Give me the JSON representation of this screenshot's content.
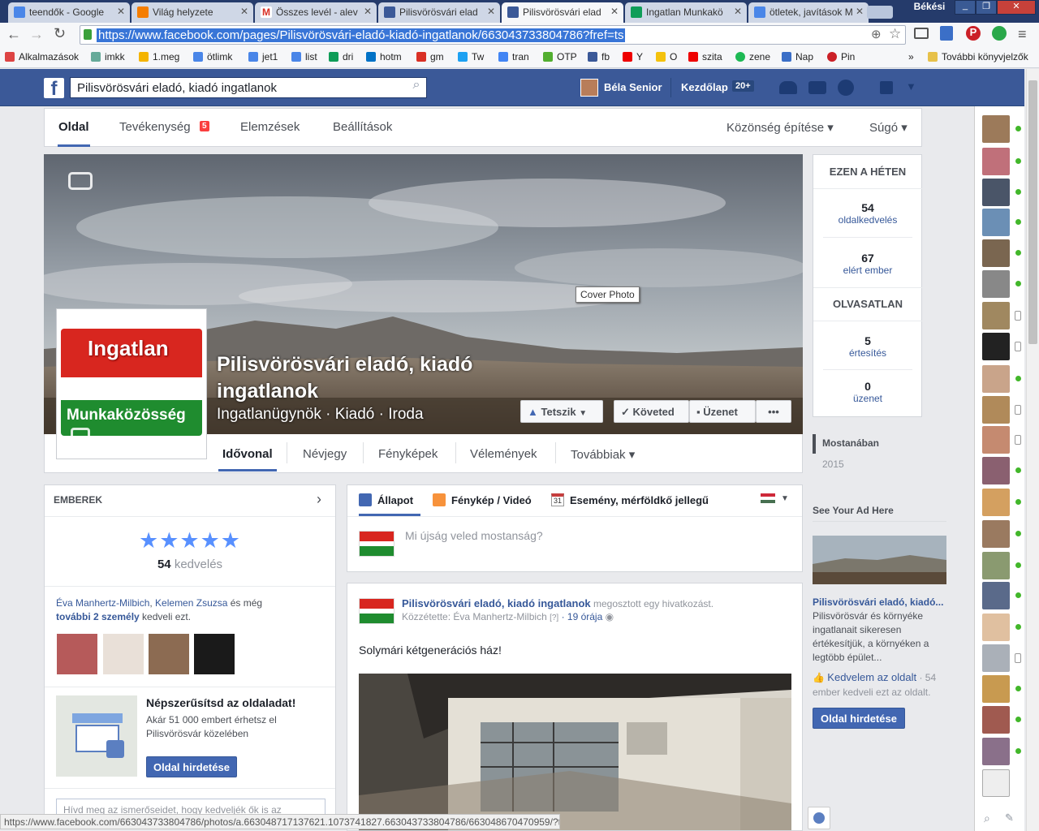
{
  "browser": {
    "tabs": [
      {
        "label": "teendők - Google",
        "color": "#4a86e8"
      },
      {
        "label": "Világ helyzete",
        "color": "#f57d00"
      },
      {
        "label": "Összes levél - alev",
        "color": "#d93025"
      },
      {
        "label": "Pilisvörösvári elad",
        "color": "#3b5998"
      },
      {
        "label": "Pilisvörösvári elad",
        "color": "#3b5998"
      },
      {
        "label": "Ingatlan Munkakö",
        "color": "#0f9d58"
      },
      {
        "label": "ötletek, javítások M",
        "color": "#4a86e8"
      }
    ],
    "user_label": "Békési",
    "url": "https://www.facebook.com/pages/Pilisvörösvári-eladó-kiadó-ingatlanok/663043733804786?fref=ts",
    "bookmarks": [
      "Alkalmazások",
      "imkk",
      "1.meg",
      "ötlimk",
      "jet1",
      "list",
      "dri",
      "hotm",
      "gm",
      "Tw",
      "tran",
      "OTP",
      "fb",
      "Y",
      "O",
      "szita",
      "zene",
      "Nap",
      "Pin"
    ],
    "bookmarks_more": "»",
    "bookmarks_folder": "További könyvjelzők",
    "status_url": "https://www.facebook.com/663043733804786/photos/a.663048717137621.1073741827.663043733804786/663048670470959/?type=1"
  },
  "fb_header": {
    "logo": "f",
    "search_value": "Pilisvörösvári eladó, kiadó ingatlanok",
    "user_name": "Béla Senior",
    "home_label": "Kezdőlap",
    "home_badge": "20+"
  },
  "page_nav": {
    "items": [
      "Oldal",
      "Tevékenység",
      "Elemzések",
      "Beállítások"
    ],
    "activity_badge": "5",
    "right": [
      "Közönség építése ▾",
      "Súgó ▾"
    ]
  },
  "cover": {
    "tooltip": "Cover Photo",
    "title_line1": "Pilisvörösvári eladó, kiadó",
    "title_line2": "ingatlanok",
    "categories": "Ingatlanügynök · Kiadó · Iroda",
    "profile_top": "Ingatlan",
    "profile_bottom": "Munkaközösség",
    "btn_like": "Tetszik",
    "btn_follow": "Követed",
    "btn_message": "Üzenet",
    "btn_more": "•••",
    "tabs": [
      "Idővonal",
      "Névjegy",
      "Fényképek",
      "Vélemények",
      "Továbbiak ▾"
    ]
  },
  "this_week": {
    "title": "EZEN A HÉTEN",
    "likes_value": "54",
    "likes_label": "oldalkedvelés",
    "reach_value": "67",
    "reach_label": "elért ember",
    "unread_title": "OLVASATLAN",
    "notif_value": "5",
    "notif_label": "értesítés",
    "msg_value": "0",
    "msg_label": "üzenet"
  },
  "timeline_nav": {
    "recent": "Mostanában",
    "year": "2015"
  },
  "ads": {
    "title": "See Your Ad Here",
    "page_name": "Pilisvörösvári eladó, kiadó...",
    "desc": "Pilisvörösvár és környéke ingatlanait sikeresen értékesítjük, a környéken a legtöbb épület...",
    "like_link": "Kedvelem az oldalt",
    "like_tail": " · 54",
    "like_count": "ember kedveli ezt az oldalt.",
    "button": "Oldal hirdetése"
  },
  "people": {
    "title": "EMBEREK",
    "stars": "★★★★★",
    "likes_value": "54",
    "likes_label": "kedvelés",
    "friend1": "Éva Manhertz-Milbich",
    "sep": ", ",
    "friend2": "Kelemen Zsuzsa",
    "and_more": " és még",
    "others": "további 2 személy",
    "likes_this": " kedveli ezt.",
    "promote_title": "Népszerűsítsd az oldaladat!",
    "promote_text": "Akár 51 000 embert érhetsz el Pilisvörösvár közelében",
    "promote_button": "Oldal hirdetése",
    "invite_placeholder": "Hívd meg az ismerőseidet, hogy kedveljék ők is az"
  },
  "composer": {
    "tab_status": "Állapot",
    "tab_photo": "Fénykép / Videó",
    "tab_event": "Esemény, mérföldkő jellegű",
    "calendar_day": "31",
    "placeholder": "Mi újság veled mostanság?"
  },
  "post": {
    "page_name": "Pilisvörösvári eladó, kiadó ingatlanok",
    "action": " megosztott egy hivatkozást.",
    "posted_by": "Közzétette: Éva Manhertz-Milbich",
    "qmark": "[?]",
    "time": "· 19 órája",
    "text": "Solymári kétgenerációs ház!"
  },
  "colors": {
    "fb_blue": "#3b5998",
    "link": "#365899",
    "online": "#42b72a"
  }
}
